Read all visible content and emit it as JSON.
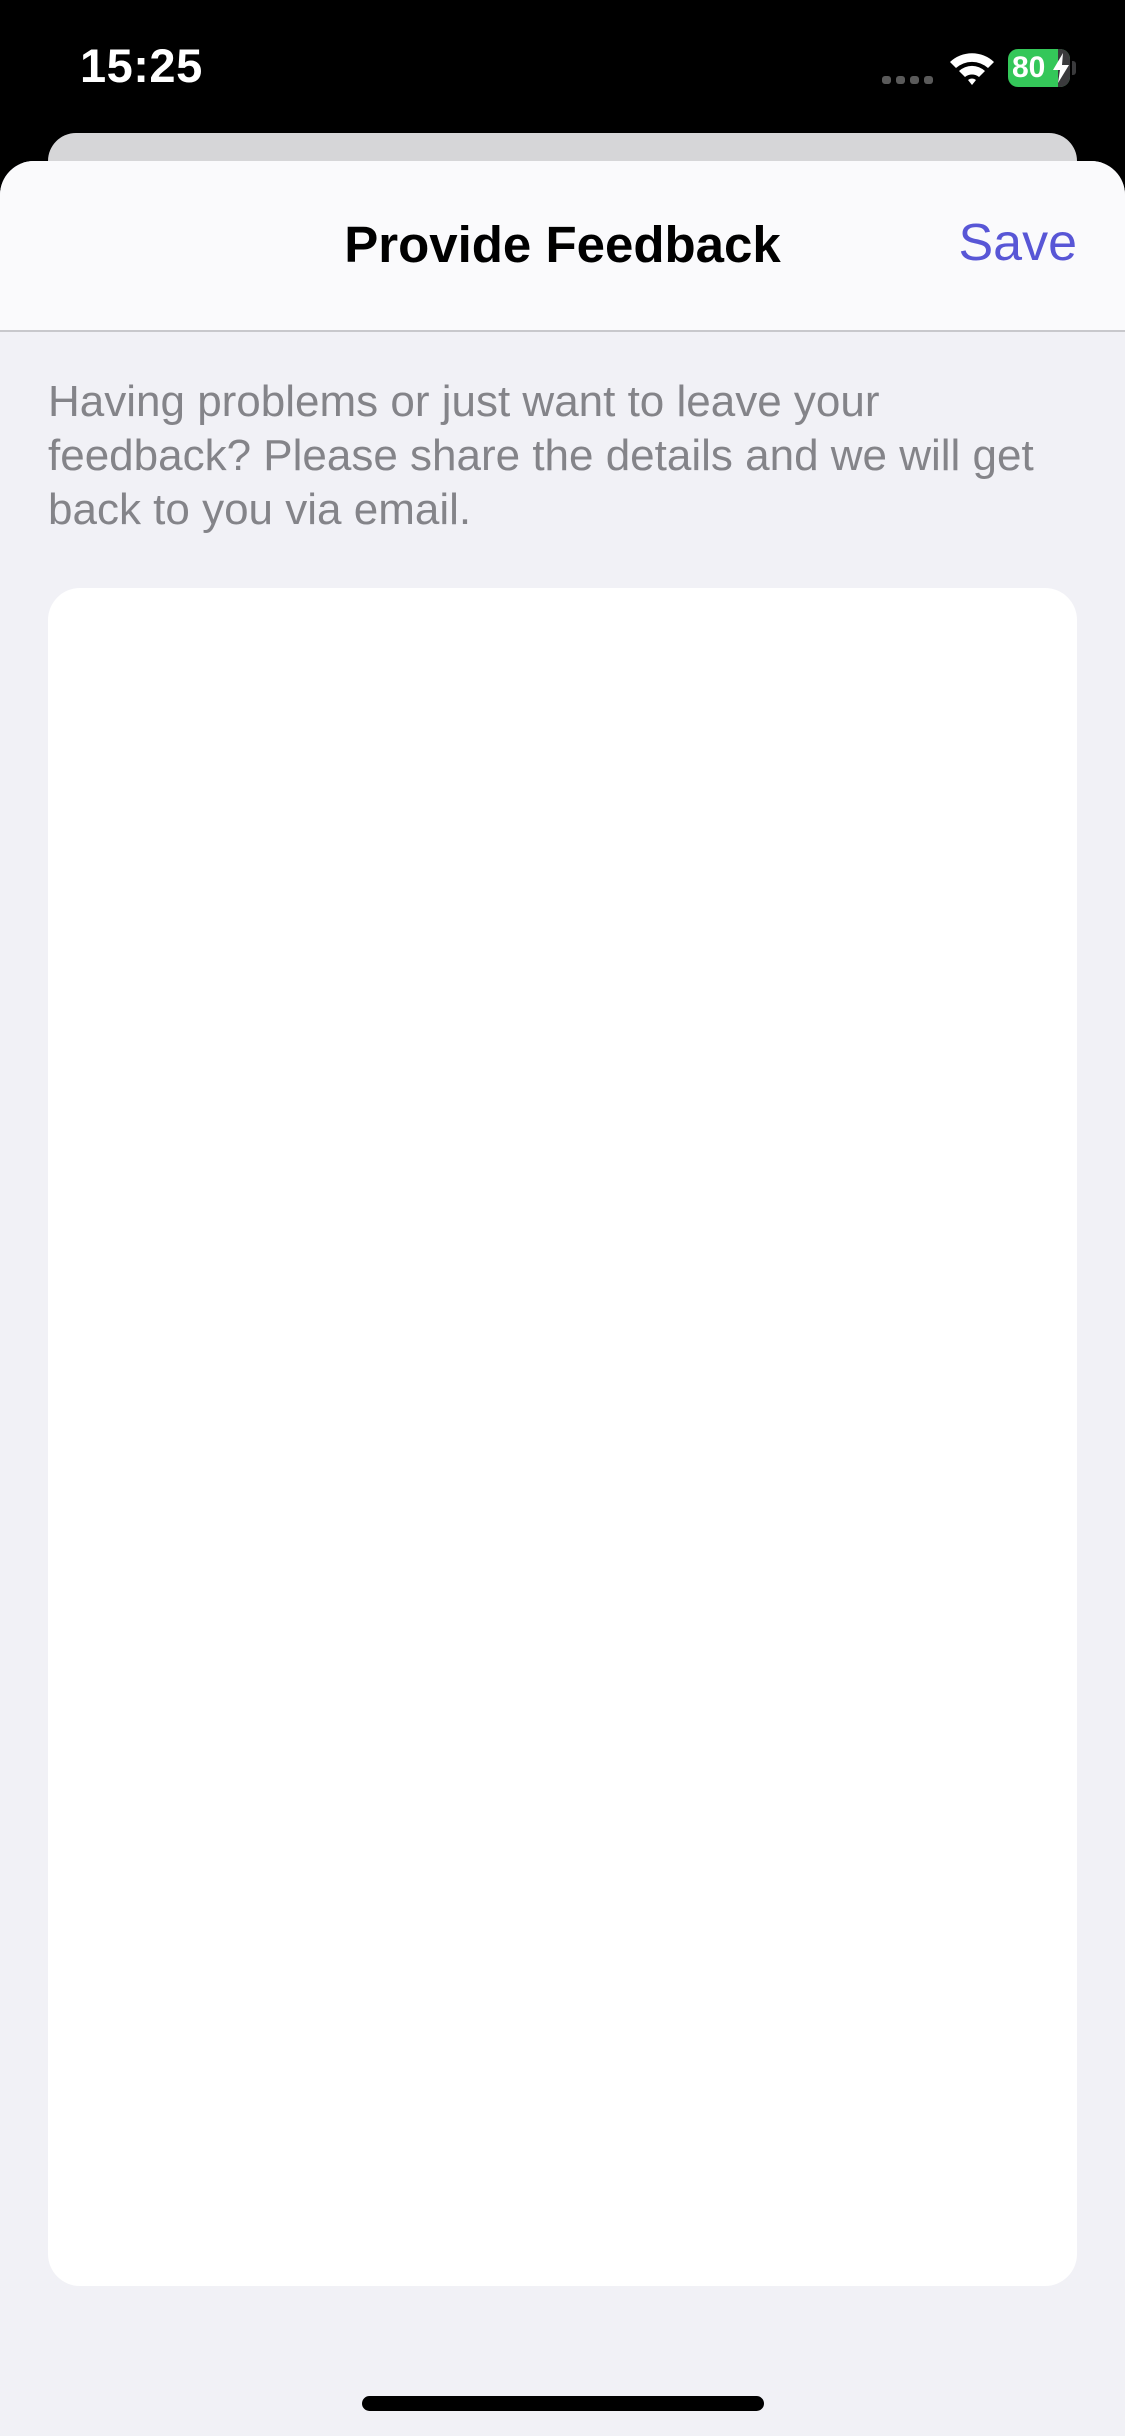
{
  "status_bar": {
    "time": "15:25",
    "battery_level": "80",
    "battery_color": "#34c759",
    "icons": [
      "signal-icon",
      "wifi-icon",
      "battery-icon",
      "charging-bolt-icon"
    ]
  },
  "nav": {
    "title": "Provide Feedback",
    "save_label": "Save",
    "accent_color": "#5856d6"
  },
  "content": {
    "description": "Having problems or just want to leave your feedback? Please share the details and we will get back to you via email.",
    "feedback_value": "",
    "feedback_placeholder": ""
  }
}
